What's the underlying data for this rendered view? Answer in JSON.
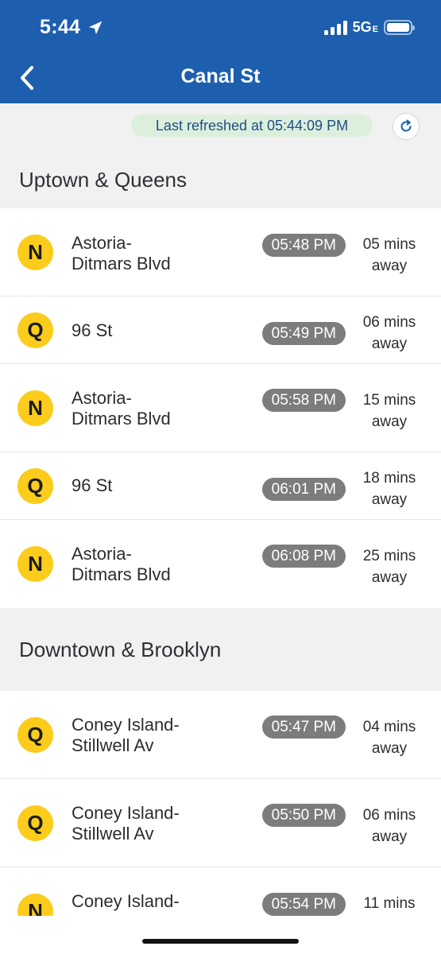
{
  "status_bar": {
    "time": "5:44",
    "network": "5G",
    "network_suffix": "E"
  },
  "nav": {
    "title": "Canal St"
  },
  "refresh": {
    "text": "Last refreshed at 05:44:09 PM"
  },
  "sections": [
    {
      "title": "Uptown & Queens",
      "rows": [
        {
          "route": "N",
          "dest_line1": "Astoria-",
          "dest_line2": "Ditmars Blvd",
          "time": "05:48 PM",
          "mins": "05 mins",
          "away": "away"
        },
        {
          "route": "Q",
          "dest_line1": "96 St",
          "dest_line2": "",
          "time": "05:49 PM",
          "mins": "06 mins",
          "away": "away"
        },
        {
          "route": "N",
          "dest_line1": "Astoria-",
          "dest_line2": "Ditmars Blvd",
          "time": "05:58 PM",
          "mins": "15 mins",
          "away": "away"
        },
        {
          "route": "Q",
          "dest_line1": "96 St",
          "dest_line2": "",
          "time": "06:01 PM",
          "mins": "18 mins",
          "away": "away"
        },
        {
          "route": "N",
          "dest_line1": "Astoria-",
          "dest_line2": "Ditmars Blvd",
          "time": "06:08 PM",
          "mins": "25 mins",
          "away": "away"
        }
      ]
    },
    {
      "title": "Downtown & Brooklyn",
      "rows": [
        {
          "route": "Q",
          "dest_line1": "Coney Island-",
          "dest_line2": "Stillwell Av",
          "time": "05:47 PM",
          "mins": "04 mins",
          "away": "away"
        },
        {
          "route": "Q",
          "dest_line1": "Coney Island-",
          "dest_line2": "Stillwell Av",
          "time": "05:50 PM",
          "mins": "06 mins",
          "away": "away"
        },
        {
          "route": "N",
          "dest_line1": "Coney Island-",
          "dest_line2": "",
          "time": "05:54 PM",
          "mins": "11 mins",
          "away": ""
        }
      ]
    }
  ],
  "colors": {
    "header_bg": "#1d5fae",
    "route_badge": "#fbcc1c",
    "time_pill": "#7c7c7e",
    "refresh_pill_bg": "#dcefdc",
    "section_bg": "#f1f1f2"
  },
  "icons": {
    "back": "chevron-left-icon",
    "location": "location-arrow-icon",
    "refresh": "refresh-icon"
  }
}
